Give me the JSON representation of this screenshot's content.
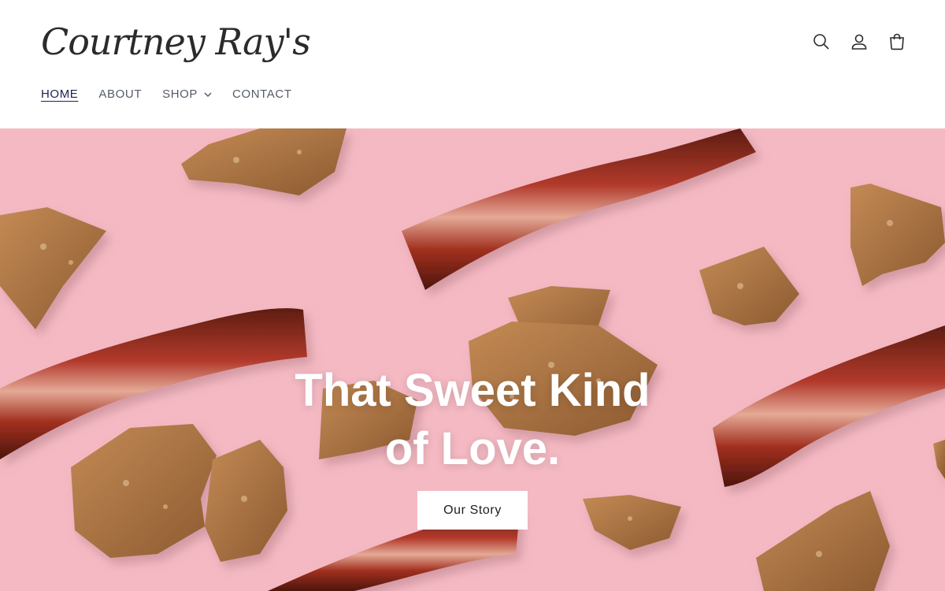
{
  "brand": {
    "logo_text": "Courtney Ray's"
  },
  "header": {
    "icons": [
      "search-icon",
      "account-icon",
      "cart-icon"
    ]
  },
  "nav": {
    "items": [
      {
        "label": "HOME",
        "active": true
      },
      {
        "label": "ABOUT",
        "active": false
      },
      {
        "label": "SHOP",
        "active": false,
        "has_dropdown": true
      },
      {
        "label": "CONTACT",
        "active": false
      }
    ]
  },
  "hero": {
    "title_line1": "That Sweet Kind",
    "title_line2": "of Love.",
    "button_label": "Our Story",
    "background_color": "#f4b9c3"
  },
  "colors": {
    "nav_active": "#1c2350",
    "nav_text": "#555b6b",
    "hero_text": "#ffffff",
    "button_bg": "#ffffff"
  }
}
